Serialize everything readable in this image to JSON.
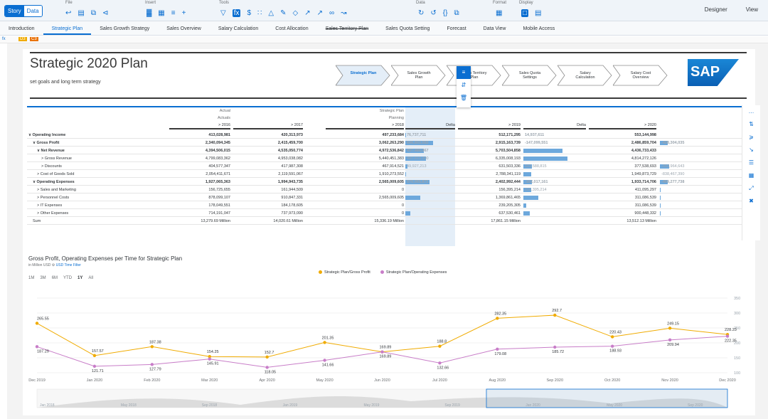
{
  "toolbar": {
    "mode_story": "Story",
    "mode_data": "Data",
    "groups": [
      "File",
      "Insert",
      "Tools",
      "Data",
      "Format",
      "Display"
    ],
    "right_links": [
      "Designer",
      "View"
    ]
  },
  "tabs": [
    {
      "label": "Introduction",
      "active": false,
      "strike": false
    },
    {
      "label": "Strategic Plan",
      "active": true,
      "strike": false
    },
    {
      "label": "Sales Growth Strategy",
      "active": false,
      "strike": false
    },
    {
      "label": "Sales Overview",
      "active": false,
      "strike": false
    },
    {
      "label": "Salary Calculation",
      "active": false,
      "strike": false
    },
    {
      "label": "Cost Allocation",
      "active": false,
      "strike": false
    },
    {
      "label": "Sales Territory Plan",
      "active": false,
      "strike": true
    },
    {
      "label": "Sales Quota Setting",
      "active": false,
      "strike": false
    },
    {
      "label": "Forecast",
      "active": false,
      "strike": false
    },
    {
      "label": "Data View",
      "active": false,
      "strike": false
    },
    {
      "label": "Mobile Access",
      "active": false,
      "strike": false
    }
  ],
  "formula_bar": {
    "fx": "fx",
    "tag1": "D3",
    "tag2": "C3"
  },
  "page": {
    "title": "Strategic 2020 Plan",
    "subtitle": "set goals and long term strategy",
    "process_steps": [
      {
        "line1": "Strategic Plan",
        "line2": "",
        "active": true
      },
      {
        "line1": "Sales Growth",
        "line2": "Plan",
        "active": false
      },
      {
        "line1": "Sales Territory",
        "line2": "Plan",
        "active": false
      },
      {
        "line1": "Sales Quota",
        "line2": "Settings",
        "active": false
      },
      {
        "line1": "Salary",
        "line2": "Calculation",
        "active": false
      },
      {
        "line1": "Salary Cost",
        "line2": "Overview",
        "active": false
      }
    ],
    "logo_text": "SAP"
  },
  "table": {
    "header_actual": "Actual",
    "header_actuals": "Actuals",
    "header_strategic": "Strategic Plan",
    "header_planning": "Planning",
    "years": [
      "> 2016",
      "> 2017",
      "> 2018",
      "Delta",
      "> 2019",
      "Delta",
      "> 2020"
    ],
    "rows": [
      {
        "label": "∨ Operating Income",
        "indent": 0,
        "bold": true,
        "v2016": "413,028,981",
        "v2017": "420,313,973",
        "v2018": "497,233,684",
        "d18": "76,737,711",
        "v2019": "512,171,295",
        "d19": "14,937,611",
        "v2020": "553,144,998",
        "d20": ""
      },
      {
        "label": "∨ Gross Profit",
        "indent": 1,
        "bold": true,
        "v2016": "2,340,094,345",
        "v2017": "2,415,459,700",
        "v2018": "3,062,263,290",
        "d18": "646,803,582",
        "v2019": "2,915,163,739",
        "d19": "-147,099,551",
        "v2020": "2,486,859,704",
        "d20": "-428,304,035"
      },
      {
        "label": "∨ Net Revenue",
        "indent": 2,
        "bold": true,
        "v2016": "4,394,506,015",
        "v2017": "4,535,050,774",
        "v2018": "4,972,536,842",
        "d18": "437,486,067",
        "v2019": "5,703,504,858",
        "d19": "",
        "v2020": "4,436,733,433",
        "d20": ""
      },
      {
        "label": "> Gross Revenue",
        "indent": 3,
        "bold": false,
        "v2016": "4,799,083,362",
        "v2017": "4,953,038,082",
        "v2018": "5,440,451,383",
        "d18": "487,413,300",
        "v2019": "6,335,008,193",
        "d19": "",
        "v2020": "4,814,272,126",
        "d20": ""
      },
      {
        "label": "> Discounts",
        "indent": 3,
        "bold": false,
        "v2016": "404,577,347",
        "v2017": "417,987,308",
        "v2018": "467,914,521",
        "d18": "49,927,213",
        "v2019": "631,503,336",
        "d19": "163,588,815",
        "v2020": "377,538,693",
        "d20": "-253,964,643"
      },
      {
        "label": "> Cost of Goods Sold",
        "indent": 2,
        "bold": false,
        "v2016": "2,054,411,671",
        "v2017": "2,119,591,067",
        "v2018": "1,910,273,552",
        "d18": "",
        "v2019": "2,788,341,119",
        "d19": "",
        "v2020": "1,949,873,729",
        "d20": "-838,467,390"
      },
      {
        "label": "∨ Operating Expenses",
        "indent": 1,
        "bold": true,
        "v2016": "1,927,065,363",
        "v2017": "1,994,943,735",
        "v2018": "2,565,009,605",
        "d18": "570,065,871",
        "v2019": "2,402,992,444",
        "d19": "-162,017,161",
        "v2020": "1,933,714,706",
        "d20": "-469,277,738"
      },
      {
        "label": "> Sales and Marketing",
        "indent": 2,
        "bold": false,
        "v2016": "156,725,655",
        "v2017": "161,944,509",
        "v2018": "0",
        "d18": "",
        "v2019": "156,395,214",
        "d19": "156,395,214",
        "v2020": "411,095,297",
        "d20": ""
      },
      {
        "label": "> Personnel Costs",
        "indent": 2,
        "bold": false,
        "v2016": "878,099,107",
        "v2017": "910,847,331",
        "v2018": "2,565,009,605",
        "d18": "",
        "v2019": "1,369,861,465",
        "d19": "",
        "v2020": "311,086,539",
        "d20": ""
      },
      {
        "label": "> IT Expenses",
        "indent": 2,
        "bold": false,
        "v2016": "178,049,551",
        "v2017": "184,178,605",
        "v2018": "0",
        "d18": "",
        "v2019": "239,205,305",
        "d19": "",
        "v2020": "311,086,539",
        "d20": ""
      },
      {
        "label": "> Other Expenses",
        "indent": 2,
        "bold": false,
        "v2016": "714,191,047",
        "v2017": "737,973,090",
        "v2018": "0",
        "d18": "",
        "v2019": "637,530,461",
        "d19": "",
        "v2020": "900,448,332",
        "d20": ""
      },
      {
        "label": "Sum",
        "indent": 1,
        "bold": false,
        "v2016": "13,279.69 Million",
        "v2017": "14,020.61 Million",
        "v2018": "15,336.19 Million",
        "d18": "",
        "v2019": "17,861.15 Million",
        "d19": "",
        "v2020": "13,512.13 Million",
        "d20": ""
      }
    ],
    "bar_fractions": [
      {
        "d18": 0.02,
        "d19": 0.0,
        "d20": 0.0
      },
      {
        "d18": 0.55,
        "d19": 0.0,
        "d20": 0.18
      },
      {
        "d18": 0.37,
        "d19": 0.62,
        "d20": 0.0
      },
      {
        "d18": 0.41,
        "d19": 0.7,
        "d20": 0.0
      },
      {
        "d18": 0.04,
        "d19": 0.14,
        "d20": 0.22
      },
      {
        "d18": 0.01,
        "d19": 0.12,
        "d20": 0.0
      },
      {
        "d18": 0.48,
        "d19": 0.14,
        "d20": 0.18
      },
      {
        "d18": 0.0,
        "d19": 0.13,
        "d20": 0.02
      },
      {
        "d18": 0.3,
        "d19": 0.24,
        "d20": 0.02
      },
      {
        "d18": 0.0,
        "d19": 0.05,
        "d20": 0.02
      },
      {
        "d18": 0.1,
        "d19": 0.1,
        "d20": 0.02
      },
      {
        "d18": 0.0,
        "d19": 0.0,
        "d20": 0.0
      }
    ]
  },
  "side_panel_icons": [
    "more-icon",
    "sort-icon",
    "filter-icon",
    "drill-icon",
    "comment-icon",
    "chart-icon",
    "fullscreen-icon",
    "delete-icon"
  ],
  "chart": {
    "title": "Gross Profit, Operating Expenses per Time for Strategic Plan",
    "subtitle_prefix": "in Million USD",
    "subtitle_link": "USD  Time Filter",
    "range_buttons": [
      "1M",
      "3M",
      "6M",
      "YTD",
      "1Y",
      "All"
    ],
    "range_selected": "1Y"
  },
  "chart_data": {
    "type": "line",
    "categories": [
      "Dec 2019",
      "Jan 2020",
      "Feb 2020",
      "Mar 2020",
      "Apr 2020",
      "May 2020",
      "Jun 2020",
      "Jul 2020",
      "Aug 2020",
      "Sep 2020",
      "Oct 2020",
      "Nov 2020",
      "Dec 2020"
    ],
    "x_axis_ticks": [
      "Dec 2019",
      "Jan 2020",
      "Feb 2020",
      "Mar 2020",
      "Apr 2020",
      "May 2020",
      "Jun 2020",
      "Jul 2020",
      "Aug 2020",
      "Sep 2020",
      "Oct 2020",
      "Nov 2020",
      "Dec 2020"
    ],
    "series": [
      {
        "name": "Strategic Plan/Gross Profit",
        "color": "#f0ab00",
        "values": [
          265.55,
          157.57,
          187.38,
          154.25,
          152.7,
          201.35,
          169.89,
          188.8,
          282.35,
          292.7,
          220.43,
          249.15,
          228.23
        ]
      },
      {
        "name": "Strategic Plan/Operating Expenses",
        "color": "#c87dc8",
        "values": [
          187.29,
          121.71,
          127.79,
          145.91,
          118.05,
          141.66,
          169.89,
          132.66,
          179.08,
          185.72,
          188.93,
          209.94,
          222.35
        ]
      }
    ],
    "y_ticks": [
      "350",
      "300",
      "250",
      "200",
      "150",
      "100"
    ],
    "ylim": [
      100,
      350
    ],
    "navigator_labels": [
      "Jan 2018",
      "May 2018",
      "Sep 2018",
      "Jan 2019",
      "May 2019",
      "Sep 2019",
      "Jan 2020",
      "May 2020",
      "Sep 2020"
    ],
    "grid": true,
    "legend": "top-center"
  }
}
